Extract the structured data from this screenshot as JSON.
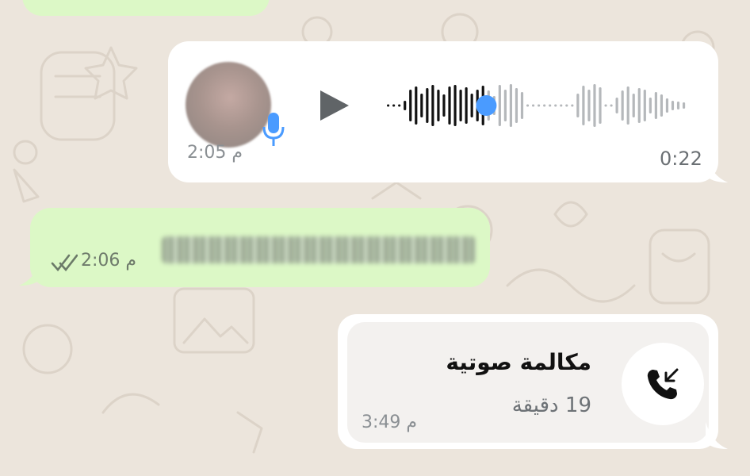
{
  "chat": {
    "voice_message": {
      "sent_time": "2:05 م",
      "duration": "0:22",
      "progress": 0.33
    },
    "text_message": {
      "sent_time": "2:06 م",
      "status_icon": "double-check-icon"
    },
    "call_message": {
      "title": "مكالمة صوتية",
      "duration_text": "19 دقيقة",
      "sent_time": "3:49 م",
      "icon": "incoming-call-icon"
    }
  },
  "colors": {
    "background": "#ece5dc",
    "incoming_bubble": "#ffffff",
    "outgoing_bubble": "#dcf8c6",
    "accent_blue": "#4a9bff",
    "text_secondary": "#8a8f93"
  }
}
